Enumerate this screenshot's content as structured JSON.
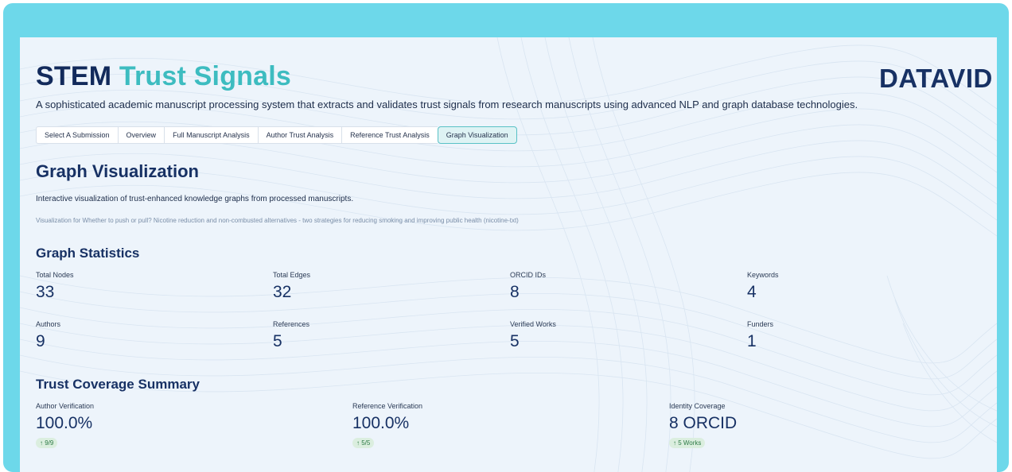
{
  "header": {
    "title_part1": "STEM",
    "title_part2": "Trust Signals",
    "logo_text": "DATAVID",
    "subtitle": "A sophisticated academic manuscript processing system that extracts and validates trust signals from research manuscripts using advanced NLP and graph database technologies."
  },
  "tabs": [
    {
      "label": "Select A Submission",
      "active": false
    },
    {
      "label": "Overview",
      "active": false
    },
    {
      "label": "Full Manuscript Analysis",
      "active": false
    },
    {
      "label": "Author Trust Analysis",
      "active": false
    },
    {
      "label": "Reference Trust Analysis",
      "active": false
    },
    {
      "label": "Graph Visualization",
      "active": true
    }
  ],
  "page": {
    "title": "Graph Visualization",
    "description": "Interactive visualization of trust-enhanced knowledge graphs from processed manuscripts.",
    "visualization_for": "Visualization for Whether to push or pull? Nicotine reduction and non-combusted alternatives - two strategies for reducing smoking and improving public health (nicotine-txt)"
  },
  "graph_statistics": {
    "heading": "Graph Statistics",
    "stats": [
      {
        "label": "Total Nodes",
        "value": "33"
      },
      {
        "label": "Total Edges",
        "value": "32"
      },
      {
        "label": "ORCID IDs",
        "value": "8"
      },
      {
        "label": "Keywords",
        "value": "4"
      },
      {
        "label": "Authors",
        "value": "9"
      },
      {
        "label": "References",
        "value": "5"
      },
      {
        "label": "Verified Works",
        "value": "5"
      },
      {
        "label": "Funders",
        "value": "1"
      }
    ]
  },
  "trust_coverage": {
    "heading": "Trust Coverage Summary",
    "items": [
      {
        "label": "Author Verification",
        "value": "100.0%",
        "delta": "↑ 9/9"
      },
      {
        "label": "Reference Verification",
        "value": "100.0%",
        "delta": "↑ 5/5"
      },
      {
        "label": "Identity Coverage",
        "value": "8 ORCID",
        "delta": "↑ 5 Works"
      }
    ]
  },
  "colors": {
    "frame": "#6dd8ea",
    "background": "#edf4fb",
    "navy": "#173164",
    "teal_accent": "#3dbcc0",
    "delta_green": "#2c7a45"
  }
}
